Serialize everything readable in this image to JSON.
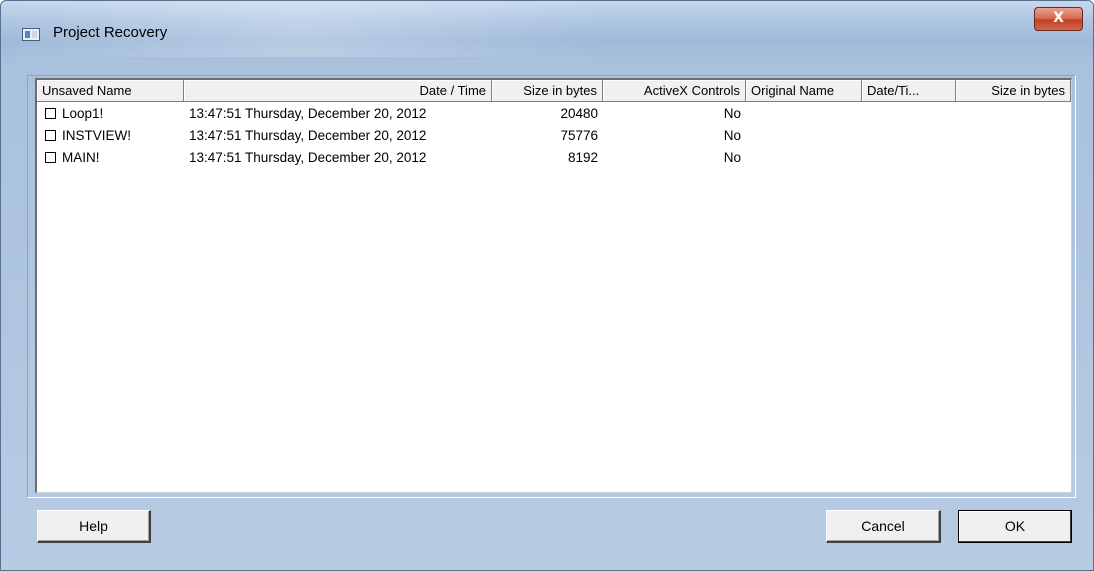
{
  "window": {
    "title": "Project Recovery",
    "close_glyph": "X"
  },
  "list": {
    "columns": [
      {
        "label": "Unsaved Name"
      },
      {
        "label": "Date / Time"
      },
      {
        "label": "Size in bytes"
      },
      {
        "label": "ActiveX Controls"
      },
      {
        "label": "Original Name"
      },
      {
        "label": "Date/Ti..."
      },
      {
        "label": "Size in bytes"
      }
    ],
    "rows": [
      {
        "name": "Loop1!",
        "checked": false,
        "datetime": "13:47:51 Thursday, December 20, 2012",
        "size": "20480",
        "activex": "No",
        "original_name": "",
        "original_date": "",
        "original_size": ""
      },
      {
        "name": "INSTVIEW!",
        "checked": false,
        "datetime": "13:47:51 Thursday, December 20, 2012",
        "size": "75776",
        "activex": "No",
        "original_name": "",
        "original_date": "",
        "original_size": ""
      },
      {
        "name": "MAIN!",
        "checked": false,
        "datetime": "13:47:51 Thursday, December 20, 2012",
        "size": "8192",
        "activex": "No",
        "original_name": "",
        "original_date": "",
        "original_size": ""
      }
    ]
  },
  "buttons": {
    "help": "Help",
    "cancel": "Cancel",
    "ok": "OK"
  }
}
